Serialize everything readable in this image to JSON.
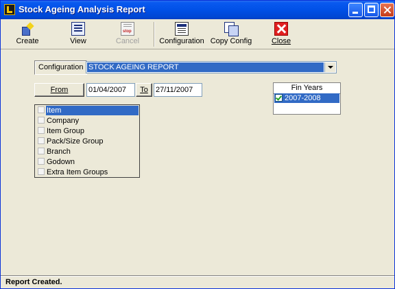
{
  "window": {
    "title": "Stock Ageing Analysis Report"
  },
  "toolbar": {
    "create": {
      "label": "Create",
      "icon": "create-icon"
    },
    "view": {
      "label": "View",
      "icon": "view-icon"
    },
    "cancel": {
      "label": "Cancel",
      "icon": "cancel-icon",
      "enabled": false
    },
    "configuration": {
      "label": "Configuration",
      "icon": "configuration-icon"
    },
    "copy_config": {
      "label": "Copy Config",
      "icon": "copy-config-icon"
    },
    "close": {
      "label": "Close",
      "icon": "close-icon"
    }
  },
  "configuration": {
    "label": "Configuration",
    "selected": "STOCK AGEING REPORT"
  },
  "dates": {
    "from_label": "From",
    "from_value": "01/04/2007",
    "to_label": "To",
    "to_value": "27/11/2007"
  },
  "items": [
    {
      "label": "Item",
      "checked": false,
      "selected": true
    },
    {
      "label": "Company",
      "checked": false
    },
    {
      "label": "Item Group",
      "checked": false
    },
    {
      "label": "Pack/Size Group",
      "checked": false
    },
    {
      "label": "Branch",
      "checked": false
    },
    {
      "label": "Godown",
      "checked": false
    },
    {
      "label": "Extra Item Groups",
      "checked": false
    }
  ],
  "fin_years": {
    "header": "Fin Years",
    "rows": [
      {
        "label": "2007-2008",
        "checked": true
      }
    ]
  },
  "status": {
    "text": "Report Created."
  },
  "colors": {
    "titlebar": "#0050e6",
    "selection": "#316ac5",
    "window_bg": "#ece9d8"
  }
}
